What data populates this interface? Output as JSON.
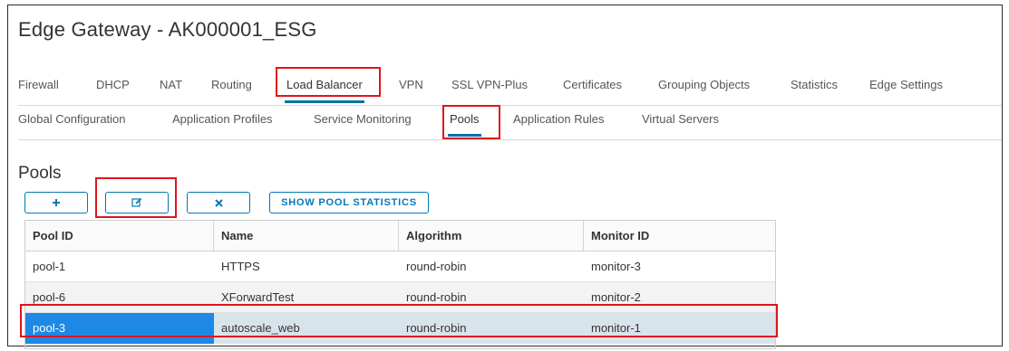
{
  "title": "Edge Gateway - AK000001_ESG",
  "main_tabs": [
    {
      "label": "Firewall"
    },
    {
      "label": "DHCP"
    },
    {
      "label": "NAT"
    },
    {
      "label": "Routing"
    },
    {
      "label": "Load Balancer",
      "active": true
    },
    {
      "label": "VPN"
    },
    {
      "label": "SSL VPN-Plus"
    },
    {
      "label": "Certificates"
    },
    {
      "label": "Grouping Objects"
    },
    {
      "label": "Statistics"
    },
    {
      "label": "Edge Settings"
    }
  ],
  "sub_tabs": [
    {
      "label": "Global Configuration"
    },
    {
      "label": "Application Profiles"
    },
    {
      "label": "Service Monitoring"
    },
    {
      "label": "Pools",
      "active": true
    },
    {
      "label": "Application Rules"
    },
    {
      "label": "Virtual Servers"
    }
  ],
  "pools": {
    "title": "Pools",
    "toolbar": {
      "add_icon": "plus-icon",
      "edit_icon": "edit-icon",
      "delete_icon": "x-icon",
      "stats_label": "SHOW POOL STATISTICS"
    },
    "columns": [
      "Pool ID",
      "Name",
      "Algorithm",
      "Monitor ID"
    ],
    "rows": [
      {
        "pool_id": "pool-1",
        "name": "HTTPS",
        "algorithm": "round-robin",
        "monitor_id": "monitor-3"
      },
      {
        "pool_id": "pool-6",
        "name": "XForwardTest",
        "algorithm": "round-robin",
        "monitor_id": "monitor-2"
      },
      {
        "pool_id": "pool-3",
        "name": "autoscale_web",
        "algorithm": "round-robin",
        "monitor_id": "monitor-1",
        "selected": true
      }
    ]
  },
  "colors": {
    "accent": "#0079b8",
    "highlight_box": "#e0141e",
    "selected_row": "#d9e4ea",
    "selected_cell": "#1e88e5"
  }
}
